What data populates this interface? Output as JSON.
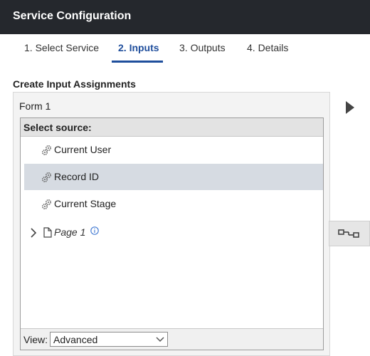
{
  "window": {
    "title": "Service Configuration"
  },
  "tabs": [
    {
      "label": "1. Select Service"
    },
    {
      "label": "2. Inputs"
    },
    {
      "label": "3. Outputs"
    },
    {
      "label": "4. Details"
    }
  ],
  "active_tab": "2. Inputs",
  "section": {
    "title": "Create Input Assignments"
  },
  "form": {
    "name": "Form 1"
  },
  "source": {
    "header": "Select source:",
    "items": [
      {
        "label": "Current User",
        "icon": "gears-icon"
      },
      {
        "label": "Record ID",
        "icon": "gears-icon",
        "selected": true
      },
      {
        "label": "Current Stage",
        "icon": "gears-icon"
      }
    ],
    "page": {
      "label": "Page 1",
      "icon": "document-icon",
      "expandable": true,
      "info_icon": "info-icon"
    }
  },
  "view": {
    "label": "View:",
    "selected": "Advanced"
  },
  "colors": {
    "titlebar": "#25282d",
    "accent": "#1f4e9c",
    "selected_row": "#d6dbe2",
    "info_icon": "#4a7fd4"
  }
}
